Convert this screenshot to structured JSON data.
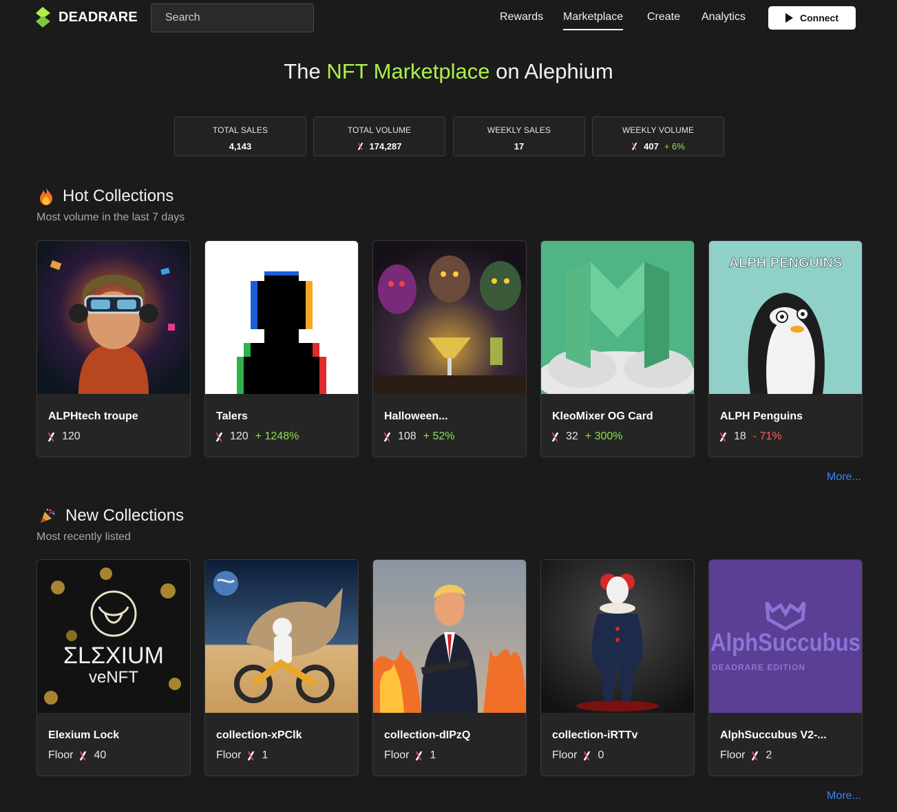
{
  "brand": {
    "name": "DEADRARE"
  },
  "search": {
    "placeholder": "Search"
  },
  "nav": {
    "links": [
      "Rewards",
      "Marketplace",
      "Create",
      "Analytics"
    ],
    "active": "Marketplace",
    "connect_label": "Connect"
  },
  "hero": {
    "prefix": "The ",
    "accent": "NFT Marketplace",
    "suffix": " on Alephium"
  },
  "stats": [
    {
      "label": "TOTAL SALES",
      "value": "4,143",
      "currency": false,
      "change": ""
    },
    {
      "label": "TOTAL VOLUME",
      "value": "174,287",
      "currency": true,
      "change": ""
    },
    {
      "label": "WEEKLY SALES",
      "value": "17",
      "currency": false,
      "change": ""
    },
    {
      "label": "WEEKLY VOLUME",
      "value": "407",
      "currency": true,
      "change": "+ 6%"
    }
  ],
  "hot": {
    "title": "Hot Collections",
    "subtitle": "Most volume in the last 7 days",
    "more": "More...",
    "cards": [
      {
        "name": "ALPHtech troupe",
        "value": "120",
        "change": "",
        "dir": ""
      },
      {
        "name": "Talers",
        "value": "120",
        "change": "+ 1248%",
        "dir": "up"
      },
      {
        "name": "Halloween...",
        "value": "108",
        "change": "+ 52%",
        "dir": "up"
      },
      {
        "name": "KleoMixer OG Card",
        "value": "32",
        "change": "+ 300%",
        "dir": "up"
      },
      {
        "name": "ALPH Penguins",
        "value": "18",
        "change": "- 71%",
        "dir": "down",
        "image_text": "ALPH PENGUINS"
      }
    ]
  },
  "new": {
    "title": "New Collections",
    "subtitle": "Most recently listed",
    "more": "More...",
    "floor_label": "Floor",
    "cards": [
      {
        "name": "Elexium Lock",
        "value": "40",
        "image_text": "ΣLΣXIUM",
        "image_sub": "veNFT"
      },
      {
        "name": "collection-xPClk",
        "value": "1"
      },
      {
        "name": "collection-dIPzQ",
        "value": "1"
      },
      {
        "name": "collection-iRTTv",
        "value": "0"
      },
      {
        "name": "AlphSuccubus V2-...",
        "value": "2",
        "image_text": "AlphSuccubus",
        "image_sub": "DEADRARE EDITION"
      }
    ]
  },
  "colors": {
    "accent": "#aef04a",
    "up": "#8fe34f",
    "down": "#ff5c5c",
    "link": "#3b82f6",
    "background": "#1b1b1b"
  },
  "icons": [
    "logo-mark-icon",
    "play-icon",
    "alph-token-icon",
    "fire-icon",
    "party-popper-icon"
  ]
}
